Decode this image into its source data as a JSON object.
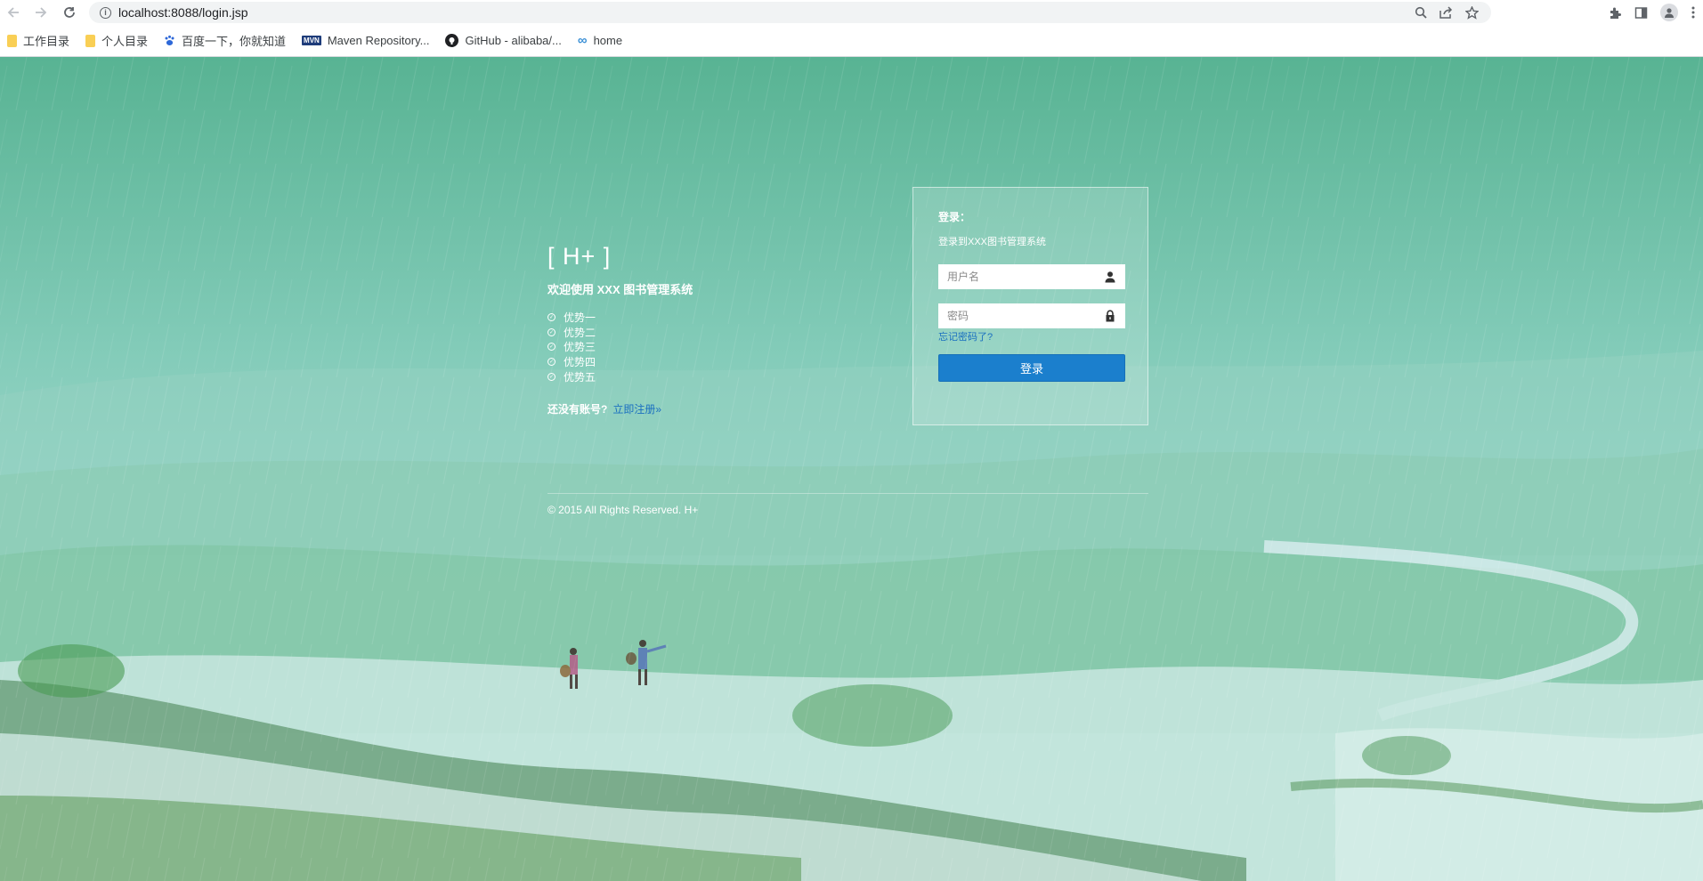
{
  "browser": {
    "url": "localhost:8088/login.jsp",
    "bookmarks": [
      {
        "label": "工作目录",
        "icon": "folder-icon"
      },
      {
        "label": "个人目录",
        "icon": "folder-icon"
      },
      {
        "label": "百度一下，你就知道",
        "icon": "baidu-paw-icon"
      },
      {
        "label": "Maven Repository...",
        "icon": "maven-icon",
        "icon_text": "MVN"
      },
      {
        "label": "GitHub - alibaba/...",
        "icon": "github-icon"
      },
      {
        "label": "home",
        "icon": "infinity-icon"
      }
    ]
  },
  "page": {
    "brand": "[ H+ ]",
    "welcome": "欢迎使用 XXX 图书管理系统",
    "features": [
      "优势一",
      "优势二",
      "优势三",
      "优势四",
      "优势五"
    ],
    "no_account": "还没有账号?",
    "register_link": "立即注册»",
    "copyright": "© 2015 All Rights Reserved. H+"
  },
  "login": {
    "title": "登录：",
    "subtitle": "登录到XXX图书管理系统",
    "username_placeholder": "用户名",
    "password_placeholder": "密码",
    "forgot": "忘记密码了?",
    "submit": "登录"
  },
  "colors": {
    "button": "#1b7fcd",
    "link": "#1a6fc0"
  }
}
